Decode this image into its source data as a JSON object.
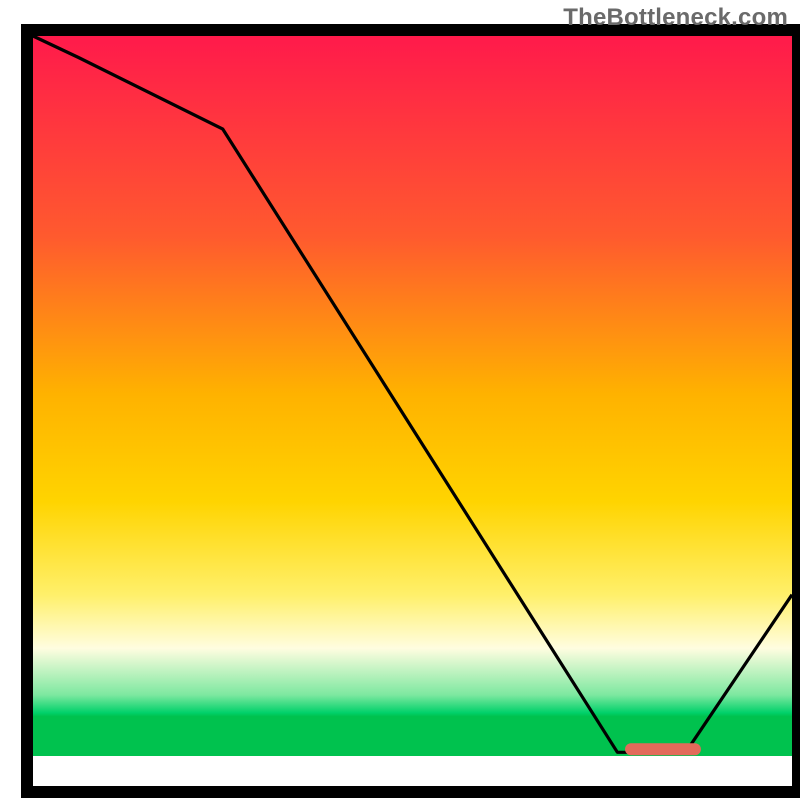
{
  "watermark": "TheBottleneck.com",
  "chart_data": {
    "type": "line",
    "title": "",
    "xlabel": "",
    "ylabel": "",
    "xlim": [
      0,
      100
    ],
    "ylim": [
      0,
      100
    ],
    "x": [
      0,
      6,
      25,
      77,
      80,
      86,
      100
    ],
    "values": [
      100,
      97,
      87,
      0,
      0,
      0,
      22
    ],
    "sweet_spot": {
      "x_start": 78,
      "x_end": 88,
      "y": 0
    },
    "gradient_stops": [
      {
        "pos": 0.0,
        "color": "#ff1a4b"
      },
      {
        "pos": 0.28,
        "color": "#ff5a2e"
      },
      {
        "pos": 0.5,
        "color": "#ffb200"
      },
      {
        "pos": 0.65,
        "color": "#ffd400"
      },
      {
        "pos": 0.78,
        "color": "#fff06a"
      },
      {
        "pos": 0.855,
        "color": "#fffde0"
      },
      {
        "pos": 0.92,
        "color": "#7de8a0"
      },
      {
        "pos": 0.945,
        "color": "#00d16a"
      },
      {
        "pos": 0.95,
        "color": "#00c24e"
      }
    ],
    "border_color": "#000000",
    "line_color": "#000000",
    "marker_color": "#e26a5a"
  }
}
